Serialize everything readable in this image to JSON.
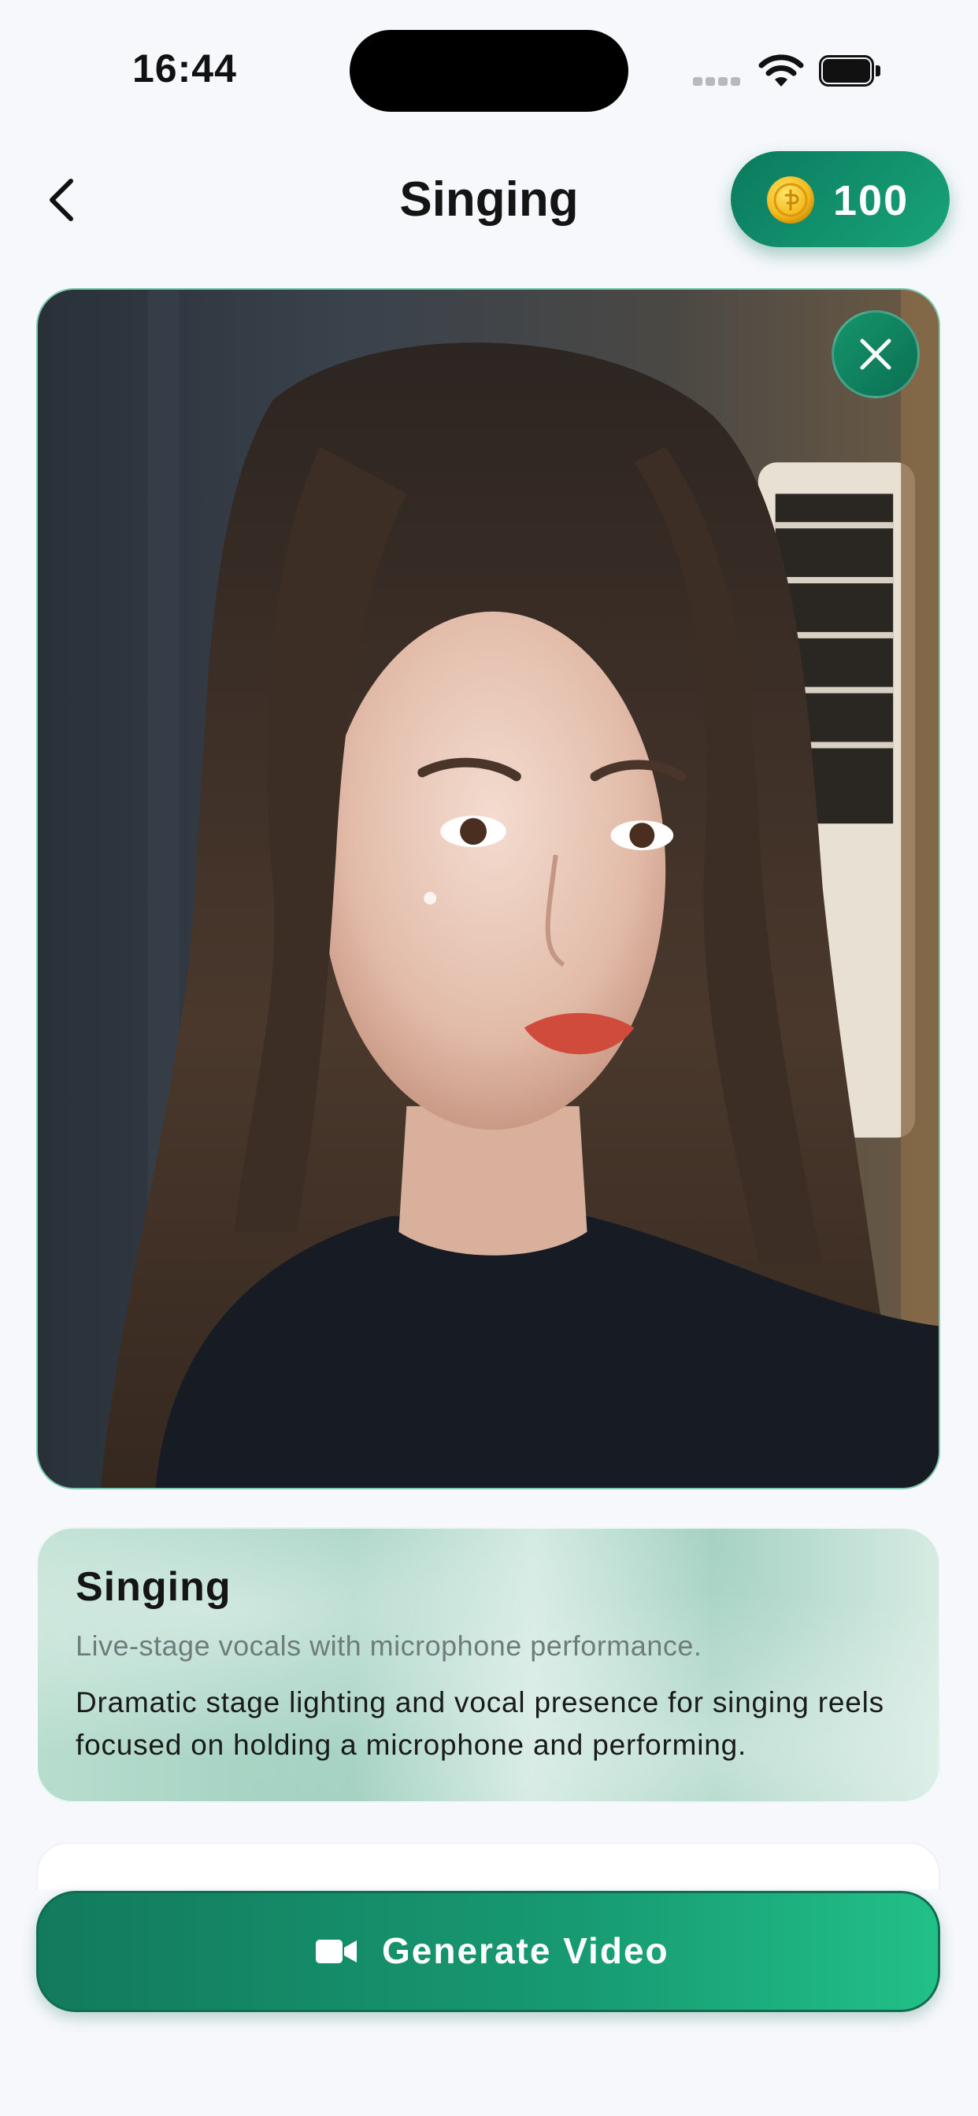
{
  "status_bar": {
    "time": "16:44"
  },
  "nav": {
    "title": "Singing",
    "coins": "100"
  },
  "style": {
    "title": "Singing",
    "subtitle": "Live-stage vocals with microphone performance.",
    "description": "Dramatic stage lighting and vocal presence for singing reels focused on holding a microphone and performing."
  },
  "actions": {
    "generate_label": "Generate Video"
  },
  "icons": {
    "back": "chevron-left-icon",
    "coin": "coin-icon",
    "close": "close-icon",
    "video": "video-camera-icon",
    "wifi": "wifi-icon",
    "battery": "battery-icon"
  },
  "colors": {
    "accent": "#179a72",
    "accent_dark": "#0b6f52",
    "background": "#f6f8fc"
  }
}
